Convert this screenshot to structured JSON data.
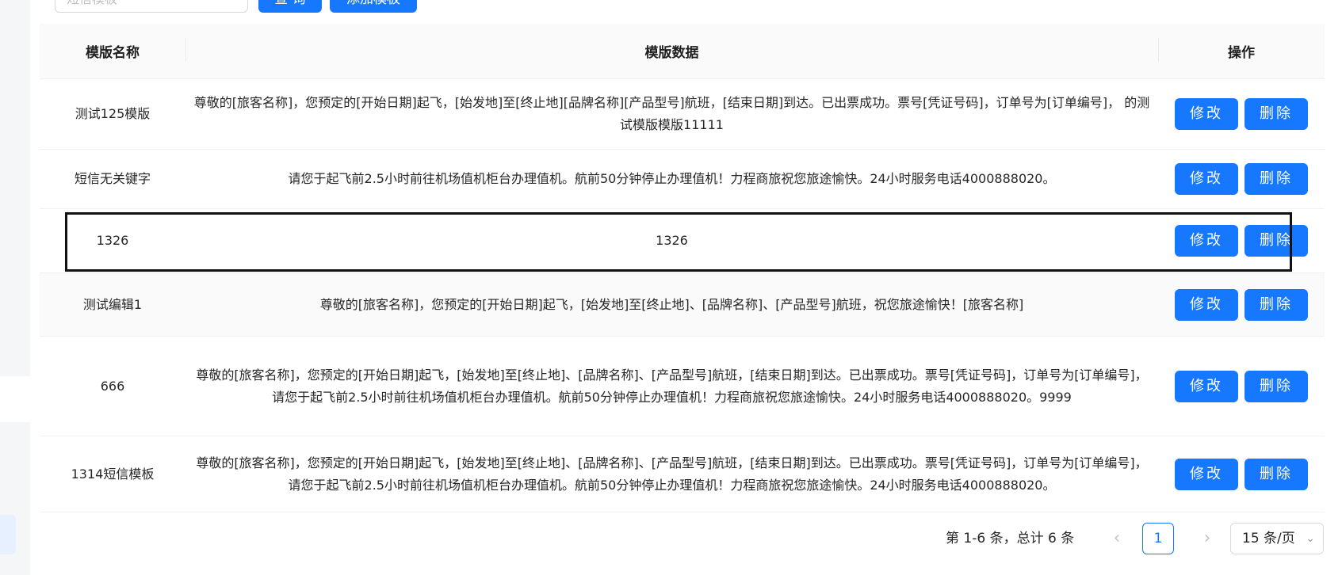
{
  "toolbar": {
    "search_placeholder": "短信模板",
    "query_label": "查 询",
    "add_label": "添加模板"
  },
  "table": {
    "headers": {
      "name": "模版名称",
      "data": "模版数据",
      "ops": "操作"
    },
    "rows": [
      {
        "name": "测试125模版",
        "data": "尊敬的[旅客名称]，您预定的[开始日期]起飞，[始发地]至[终止地][品牌名称][产品型号]航班，[结束日期]到达。已出票成功。票号[凭证号码]，订单号为[订单编号]， 的测试模版模版11111"
      },
      {
        "name": "短信无关键字",
        "data": "请您于起飞前2.5小时前往机场值机柜台办理值机。航前50分钟停止办理值机！力程商旅祝您旅途愉快。24小时服务电话4000888020。"
      },
      {
        "name": "1326",
        "data": "1326"
      },
      {
        "name": "测试编辑1",
        "data": "尊敬的[旅客名称]，您预定的[开始日期]起飞，[始发地]至[终止地]、[品牌名称]、[产品型号]航班，祝您旅途愉快！[旅客名称]"
      },
      {
        "name": "666",
        "data": "尊敬的[旅客名称]，您预定的[开始日期]起飞，[始发地]至[终止地]、[品牌名称]、[产品型号]航班，[结束日期]到达。已出票成功。票号[凭证号码]，订单号为[订单编号]， 请您于起飞前2.5小时前往机场值机柜台办理值机。航前50分钟停止办理值机！力程商旅祝您旅途愉快。24小时服务电话4000888020。9999"
      },
      {
        "name": "1314短信模板",
        "data": "尊敬的[旅客名称]，您预定的[开始日期]起飞，[始发地]至[终止地]、[品牌名称]、[产品型号]航班，[结束日期]到达。已出票成功。票号[凭证号码]，订单号为[订单编号]， 请您于起飞前2.5小时前往机场值机柜台办理值机。航前50分钟停止办理值机！力程商旅祝您旅途愉快。24小时服务电话4000888020。"
      }
    ],
    "edit_label": "修改",
    "delete_label": "删除"
  },
  "pagination": {
    "total_text": "第 1-6 条，总计 6 条",
    "prev_icon": "‹",
    "next_icon": "›",
    "current_page": "1",
    "page_size": "15 条/页",
    "page_size_icon": "⌄"
  },
  "colors": {
    "primary": "#1677ff",
    "header_bg": "#fafafa",
    "border": "#f0f0f0"
  }
}
